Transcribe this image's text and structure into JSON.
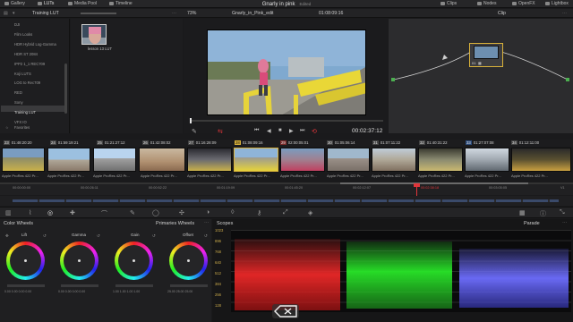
{
  "top_nav": {
    "tabs": [
      "Gallery",
      "LUTs",
      "Media Pool",
      "Timeline"
    ],
    "right_tabs": [
      "Clips",
      "Nodes",
      "OpenFX",
      "Lightbox"
    ],
    "project_title": "Gnarly in pink",
    "edit_state": "Edited"
  },
  "second_bar": {
    "lut_folder": "Training LUT",
    "zoom": "73%",
    "timeline_name": "Gnarly_in_Pink_edit",
    "timecode": "01:08:09:16",
    "mode": "Clip"
  },
  "lut_browser": {
    "items": [
      "DJI",
      "Film Looks",
      "HDR Hybrid Log-Gamma",
      "HDR ST 2084",
      "IPP2 1_1 REC709",
      "Koji LUTS",
      "LOG to Rec709",
      "RED",
      "Sony",
      "Training LUT",
      "VFX IO"
    ],
    "selected_index": 9,
    "favorites_label": "Favorites",
    "lut_thumb_label": "lesson 13 LUT"
  },
  "viewer": {
    "timecode": "00:02:37:12"
  },
  "node_editor": {
    "node_label": "01"
  },
  "timeline_clips": [
    {
      "num": "23",
      "tc": "01:48:20:20",
      "codec": "V1",
      "label": "Apple ProRes 422 Pr..."
    },
    {
      "num": "24",
      "tc": "01:59:19:21",
      "codec": "V1",
      "label": "Apple ProRes 422 Pr..."
    },
    {
      "num": "25",
      "tc": "01:21:27:12",
      "codec": "V1",
      "label": "Apple ProRes 422 Pr..."
    },
    {
      "num": "26",
      "tc": "01:42:08:02",
      "codec": "V1",
      "label": "Apple ProRes 422 Pr..."
    },
    {
      "num": "27",
      "tc": "01:16:28:09",
      "codec": "V1",
      "label": "Apple ProRes 422 Pr..."
    },
    {
      "num": "28",
      "tc": "01:08:09:16",
      "codec": "V1",
      "label": "Apple ProRes 422 Pr..."
    },
    {
      "num": "29",
      "tc": "02:00:05:01",
      "codec": "V1",
      "label": "Apple ProRes 422 Pr..."
    },
    {
      "num": "30",
      "tc": "01:05:06:14",
      "codec": "V1",
      "label": "Apple ProRes 422 Pr..."
    },
    {
      "num": "31",
      "tc": "01:07:11:22",
      "codec": "V1",
      "label": "Apple ProRes 422 Pr..."
    },
    {
      "num": "32",
      "tc": "01:40:31:22",
      "codec": "V1",
      "label": "Apple ProRes 422 Pr..."
    },
    {
      "num": "33",
      "tc": "01:27:07:08",
      "codec": "V1",
      "label": "Apple ProRes 422 Pr..."
    },
    {
      "num": "34",
      "tc": "01:12:11:00",
      "codec": "V1",
      "label": "Apple ProRes 422 Pr..."
    }
  ],
  "ruler": {
    "marks": [
      "00:00:00:00",
      "00:00:26:11",
      "00:00:52:22",
      "00:01:19:09",
      "00:01:45:20",
      "00:02:12:07",
      "00:02:38:18",
      "00:03:05:05"
    ],
    "right_label": "V1"
  },
  "color_wheels": {
    "title": "Color Wheels",
    "section_title": "Primaries Wheels",
    "wheels": [
      {
        "name": "Lift",
        "values": [
          "0.00",
          "0.00",
          "0.00",
          "0.00"
        ]
      },
      {
        "name": "Gamma",
        "values": [
          "0.00",
          "0.00",
          "0.00",
          "0.00"
        ]
      },
      {
        "name": "Gain",
        "values": [
          "1.00",
          "1.00",
          "1.00",
          "1.00"
        ]
      },
      {
        "name": "Offset",
        "values": [
          "25.00",
          "25.00",
          "25.00"
        ]
      }
    ]
  },
  "scopes": {
    "title": "Scopes",
    "mode": "Parade",
    "scale": [
      "1023",
      "896",
      "768",
      "640",
      "512",
      "384",
      "256",
      "128"
    ]
  },
  "colors": {
    "accent_red": "#e0353a",
    "selection_yellow": "#d9b23a"
  }
}
